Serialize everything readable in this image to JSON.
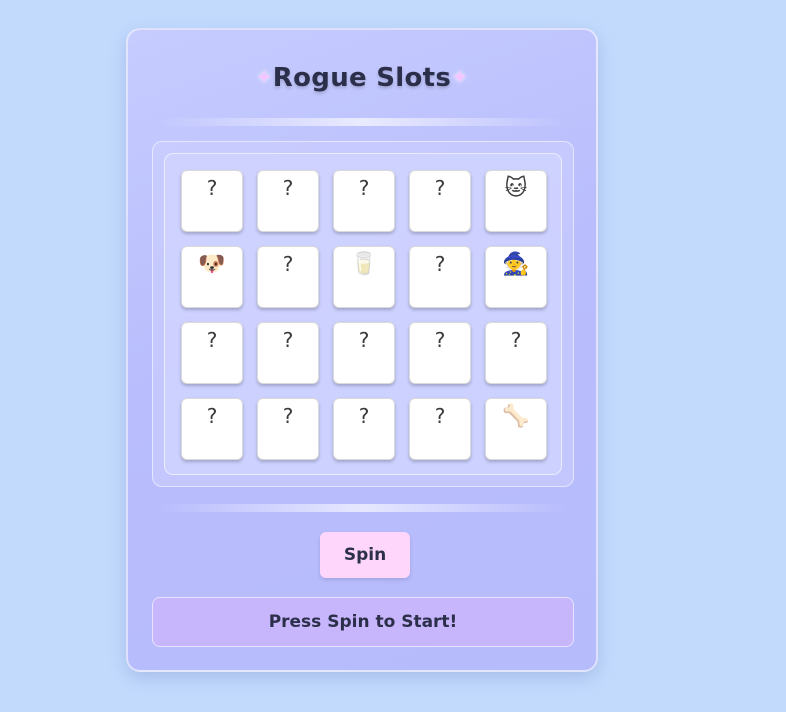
{
  "title": "Rogue Slots",
  "title_ornament": "✦",
  "grid": {
    "rows": [
      [
        "?",
        "?",
        "?",
        "?",
        "🐱"
      ],
      [
        "🐶",
        "?",
        "🥛",
        "?",
        "🧙"
      ],
      [
        "?",
        "?",
        "?",
        "?",
        "?"
      ],
      [
        "?",
        "?",
        "?",
        "?",
        "🦴"
      ]
    ],
    "cell_names": [
      [
        "hidden",
        "hidden",
        "hidden",
        "hidden",
        "cat"
      ],
      [
        "dog",
        "hidden",
        "milk",
        "hidden",
        "wizard"
      ],
      [
        "hidden",
        "hidden",
        "hidden",
        "hidden",
        "hidden"
      ],
      [
        "hidden",
        "hidden",
        "hidden",
        "hidden",
        "bone"
      ]
    ]
  },
  "spin_button_label": "Spin",
  "status_message": "Press Spin to Start!",
  "colors": {
    "background": "#c2dbfd",
    "panel": "#bcc1fd",
    "spin_button": "#ffd6fb",
    "status_bar": "#c7b6fc",
    "title_text": "#2c2f4a"
  }
}
